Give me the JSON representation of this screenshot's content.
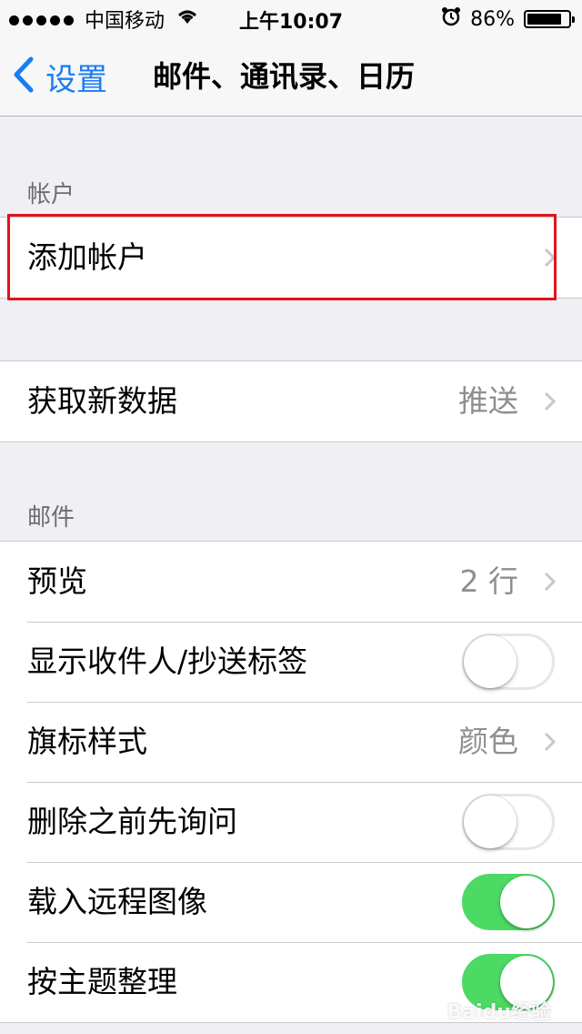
{
  "status_bar": {
    "carrier": "中国移动",
    "time": "上午10:07",
    "battery": "86%",
    "battery_level": 0.86,
    "signal_icon": "signal-dots-icon",
    "wifi_icon": "wifi-icon",
    "alarm_icon": "alarm-icon"
  },
  "nav": {
    "back_label": "设置",
    "title": "邮件、通讯录、日历"
  },
  "accounts_section": {
    "header": "帐户",
    "add_account": "添加帐户"
  },
  "fetch": {
    "label": "获取新数据",
    "value": "推送"
  },
  "mail_section": {
    "header": "邮件",
    "preview": {
      "label": "预览",
      "value": "2 行"
    },
    "show_to_cc": {
      "label": "显示收件人/抄送标签",
      "on": false
    },
    "flag_style": {
      "label": "旗标样式",
      "value": "颜色"
    },
    "ask_before_delete": {
      "label": "删除之前先询问",
      "on": false
    },
    "load_remote_images": {
      "label": "载入远程图像",
      "on": true
    },
    "organize_by_thread": {
      "label": "按主题整理",
      "on": true
    }
  },
  "colors": {
    "accent": "#1a7cf4",
    "toggle_on": "#4cd964",
    "highlight": "#e0141c",
    "background": "#efeff4"
  },
  "watermark": "Baidu经验"
}
